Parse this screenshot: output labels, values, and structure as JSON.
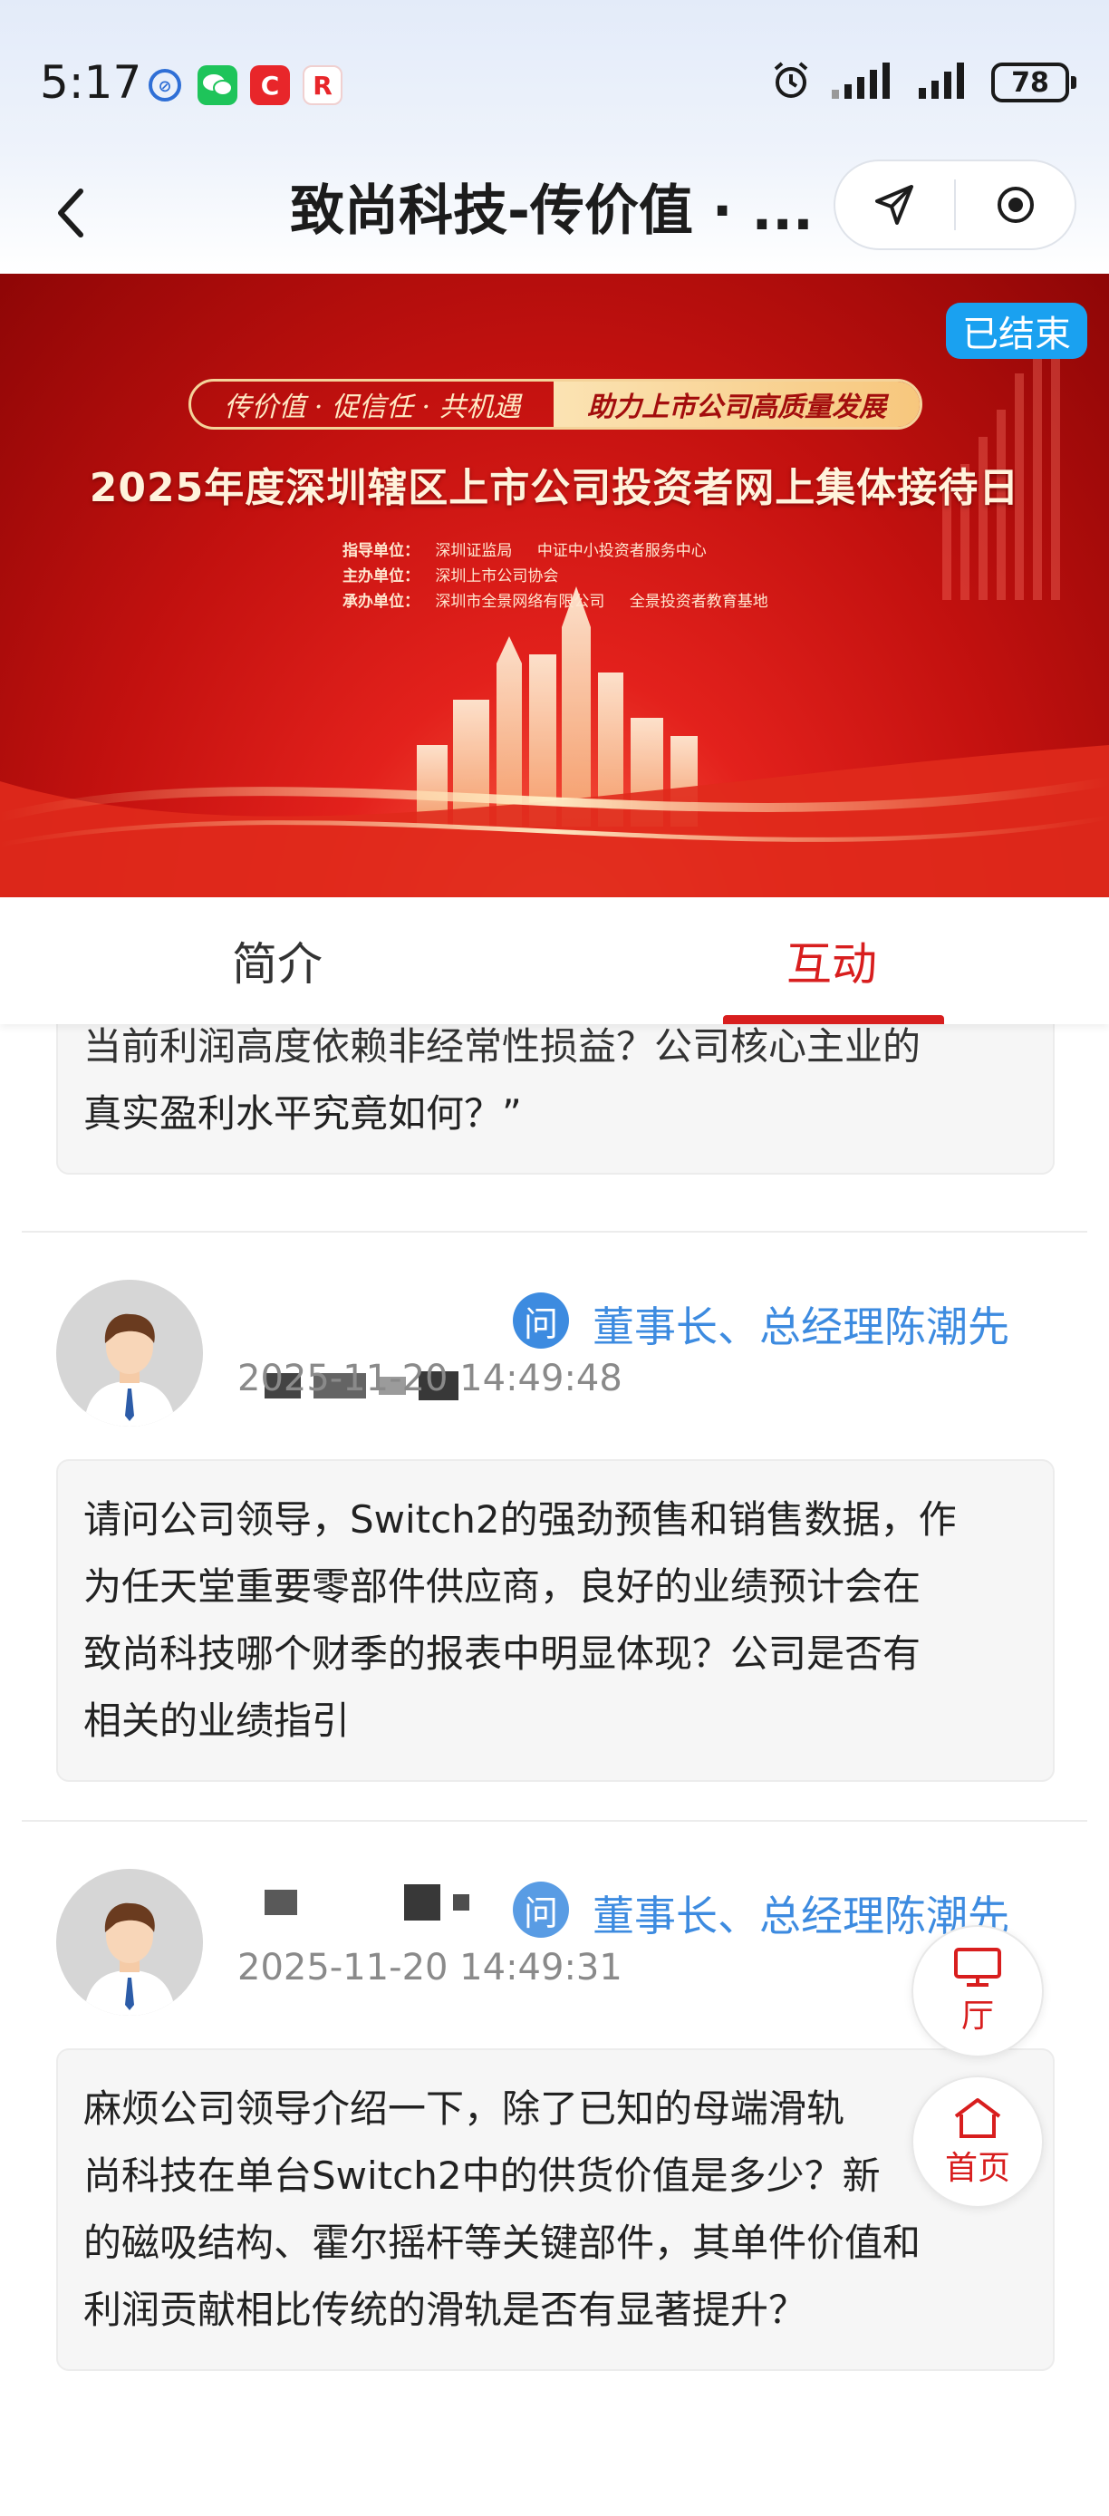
{
  "status_bar": {
    "time": "5:17",
    "battery": "78",
    "apps": [
      "link-app-icon",
      "wechat-icon",
      "c-app-icon",
      "r-app-icon"
    ],
    "right_icons": [
      "alarm-icon",
      "signal-icon-1",
      "signal-icon-2",
      "battery-icon"
    ]
  },
  "header": {
    "title": "致尚科技-传价值 · ...",
    "back_icon": "chevron-left-icon",
    "share_icon": "send-icon",
    "record_icon": "target-icon"
  },
  "banner": {
    "status_tag": "已结束",
    "slogan_left": "传价值 · 促信任 · 共机遇",
    "slogan_right": "助力上市公司高质量发展",
    "headline": "2025年度深圳辖区上市公司投资者网上集体接待日",
    "organizers": [
      {
        "label": "指导单位：",
        "values": [
          "深圳证监局",
          "中证中小投资者服务中心"
        ]
      },
      {
        "label": "主办单位：",
        "values": [
          "深圳上市公司协会"
        ]
      },
      {
        "label": "承办单位：",
        "values": [
          "深圳市全景网络有限公司",
          "全景投资者教育基地"
        ]
      }
    ]
  },
  "tabs": [
    {
      "label": "简介",
      "active": false
    },
    {
      "label": "互动",
      "active": true
    }
  ],
  "feed": {
    "partial_question": {
      "line1": "当前利润高度依赖非经常性损益？公司核心主业的",
      "line2": "真实盈利水平究竟如何？”"
    },
    "posts": [
      {
        "answerer": "董事长、总经理陈潮先",
        "question_badge": "问",
        "timestamp": "2025-11-20 14:49:48",
        "question": [
          "请问公司领导，Switch2的强劲预售和销售数据，作",
          "为任天堂重要零部件供应商，良好的业绩预计会在",
          "致尚科技哪个财季的报表中明显体现？公司是否有",
          "相关的业绩指引"
        ]
      },
      {
        "answerer": "董事长、总经理陈潮先",
        "question_badge": "问",
        "timestamp": "2025-11-20 14:49:31",
        "question": [
          "麻烦公司领导介绍一下，除了已知的母端滑轨",
          "尚科技在单台Switch2中的供货价值是多少？新",
          "的磁吸结构、霍尔摇杆等关键部件，其单件价值和",
          "利润贡献相比传统的滑轨是否有显著提升？"
        ]
      }
    ]
  },
  "floating": {
    "hall_label": "厅",
    "home_label": "首页"
  },
  "colors": {
    "accent_red": "#d81e1e",
    "link_blue": "#3d8be0",
    "tag_blue": "#1aa1f0"
  }
}
